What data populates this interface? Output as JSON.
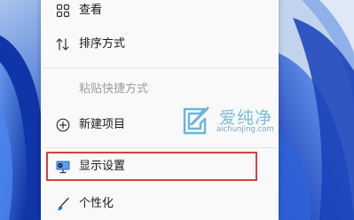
{
  "context_menu": {
    "items": [
      {
        "label": "查看",
        "icon": "grid-icon",
        "enabled": true
      },
      {
        "label": "排序方式",
        "icon": "sort-icon",
        "enabled": true
      },
      {
        "label": "粘贴快捷方式",
        "icon": "",
        "enabled": false
      },
      {
        "label": "新建项目",
        "icon": "add-circle-icon",
        "enabled": true
      },
      {
        "label": "显示设置",
        "icon": "display-settings-icon",
        "enabled": true,
        "highlighted": true
      },
      {
        "label": "个性化",
        "icon": "brush-icon",
        "enabled": true
      }
    ]
  },
  "watermark": {
    "brand": "爱纯净",
    "domain": "aichunjing.com"
  },
  "colors": {
    "menu_background": "#f9f9f9",
    "highlight_border": "#d6403f",
    "disabled_text": "#9c9c9c",
    "wallpaper_blue": "#1c3fa8"
  }
}
